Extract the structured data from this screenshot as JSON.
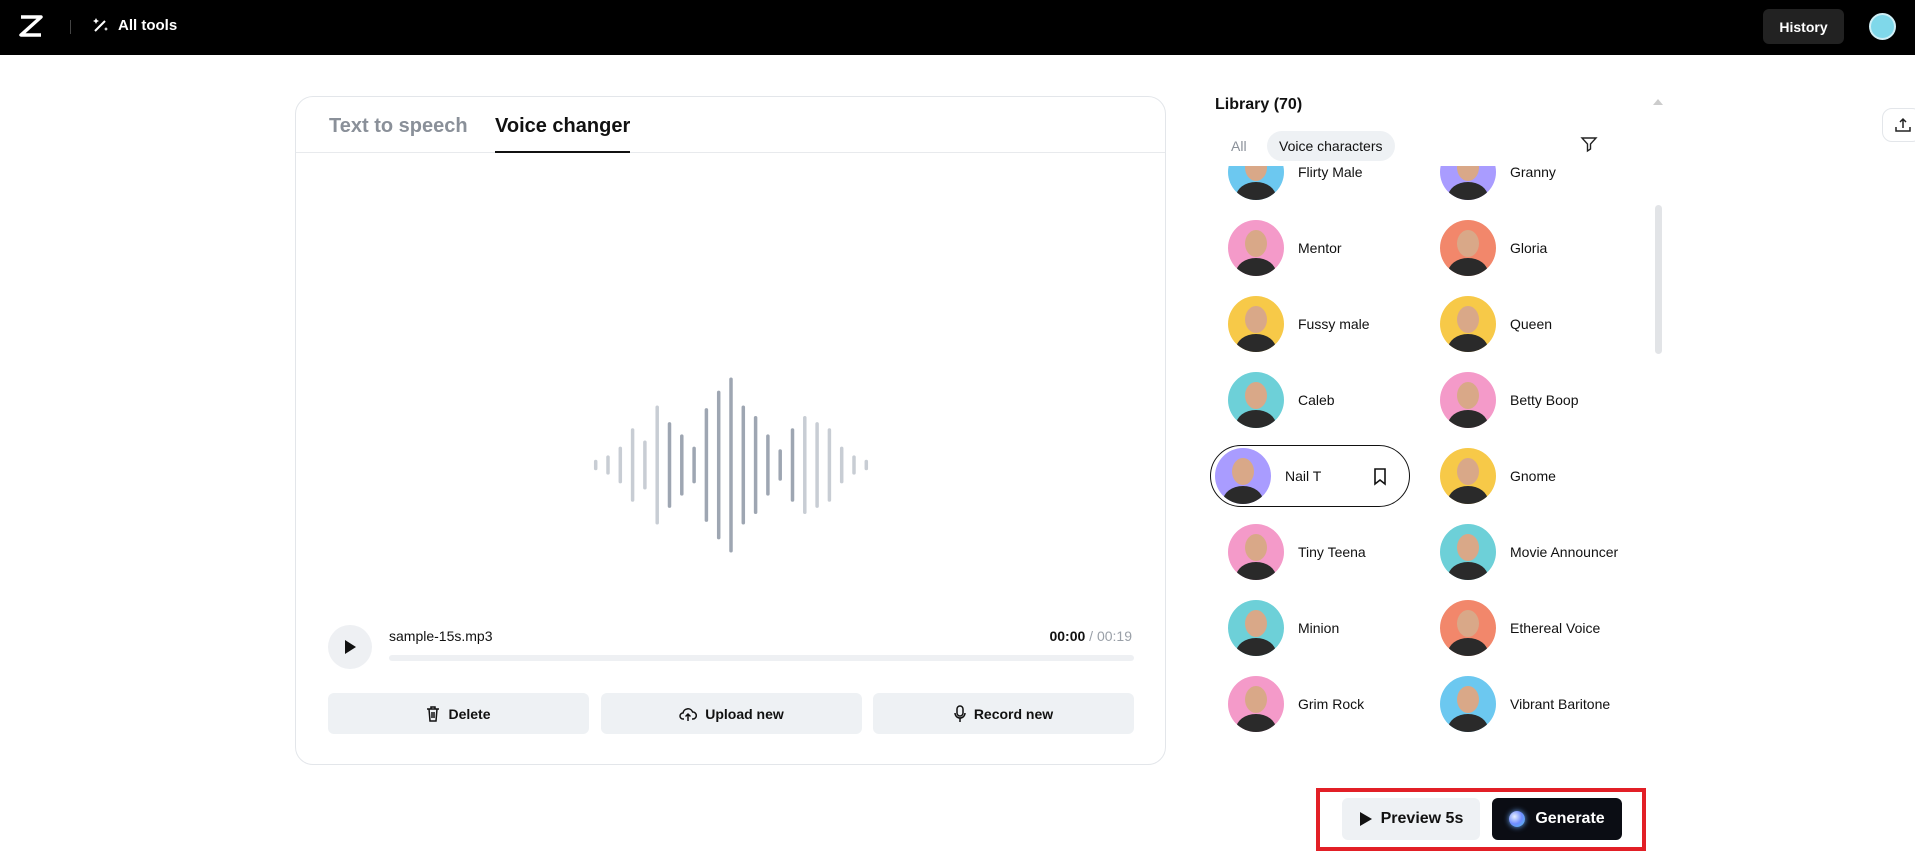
{
  "header": {
    "all_tools": "All tools",
    "history": "History"
  },
  "tabs": [
    {
      "label": "Text to speech"
    },
    {
      "label": "Voice changer"
    }
  ],
  "player": {
    "file": "sample-15s.mp3",
    "current": "00:00",
    "separator": " / ",
    "total": "00:19",
    "progress": 0
  },
  "waveform_levels": [
    0.06,
    0.11,
    0.21,
    0.42,
    0.28,
    0.68,
    0.49,
    0.35,
    0.21,
    0.65,
    0.85,
    1.0,
    0.68,
    0.56,
    0.35,
    0.18,
    0.42,
    0.56,
    0.49,
    0.42,
    0.21,
    0.11,
    0.06
  ],
  "actions": {
    "delete": "Delete",
    "upload": "Upload new",
    "record": "Record new"
  },
  "library": {
    "title": "Library (70)",
    "filters": [
      "All",
      "Voice characters"
    ],
    "voices": [
      {
        "name": "Flirty Male",
        "color": "#6cc8f0"
      },
      {
        "name": "Granny",
        "color": "#a99cff"
      },
      {
        "name": "Mentor",
        "color": "#f49ac9"
      },
      {
        "name": "Gloria",
        "color": "#f2876b"
      },
      {
        "name": "Fussy male",
        "color": "#f7c948"
      },
      {
        "name": "Queen",
        "color": "#f7c948"
      },
      {
        "name": "Caleb",
        "color": "#6dd0d8"
      },
      {
        "name": "Betty Boop",
        "color": "#f49ac9"
      },
      {
        "name": "Nail T",
        "color": "#a99cff",
        "selected": true
      },
      {
        "name": "Gnome",
        "color": "#f7c948"
      },
      {
        "name": "Tiny Teena",
        "color": "#f49ac9"
      },
      {
        "name": "Movie Announcer",
        "color": "#6dd0d8"
      },
      {
        "name": "Minion",
        "color": "#6dd0d8"
      },
      {
        "name": "Ethereal Voice",
        "color": "#f2876b"
      },
      {
        "name": "Grim Rock",
        "color": "#f49ac9"
      },
      {
        "name": "Vibrant Baritone",
        "color": "#6cc8f0"
      }
    ]
  },
  "footer": {
    "preview": "Preview 5s",
    "generate": "Generate"
  },
  "colors": {
    "highlight": "#e21f26",
    "dark": "#0b0d14"
  }
}
